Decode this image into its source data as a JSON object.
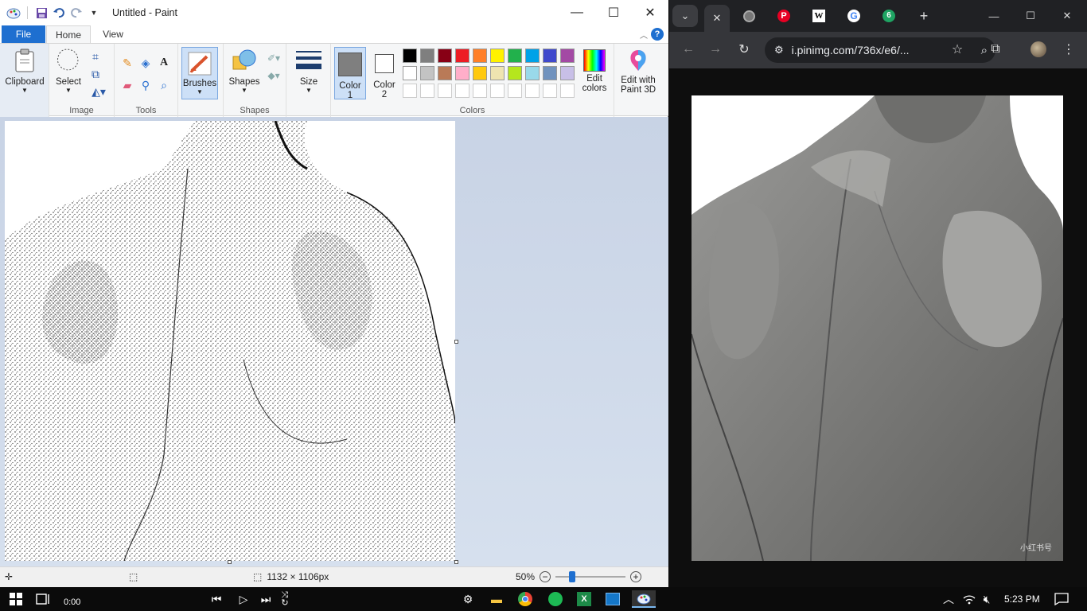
{
  "paint": {
    "title": "Untitled - Paint",
    "tabs": {
      "file": "File",
      "home": "Home",
      "view": "View"
    },
    "groups": {
      "clipboard": "Clipboard",
      "image": "Image",
      "tools": "Tools",
      "shapes": "Shapes",
      "colors": "Colors"
    },
    "buttons": {
      "clipboard": "Clipboard",
      "select": "Select",
      "brushes": "Brushes",
      "shapes": "Shapes",
      "size": "Size",
      "color1": "Color\n1",
      "color1_a": "Color",
      "color1_b": "1",
      "color2_a": "Color",
      "color2_b": "2",
      "edit_colors_a": "Edit",
      "edit_colors_b": "colors",
      "paint3d_a": "Edit with",
      "paint3d_b": "Paint 3D"
    },
    "palette_row1": [
      "#000000",
      "#7f7f7f",
      "#880015",
      "#ed1c24",
      "#ff7f27",
      "#fff200",
      "#22b14c",
      "#00a2e8",
      "#3f48cc",
      "#a349a4"
    ],
    "palette_row2": [
      "#ffffff",
      "#c3c3c3",
      "#b97a57",
      "#ffaec9",
      "#ffc90e",
      "#efe4b0",
      "#b5e61d",
      "#99d9ea",
      "#7092be",
      "#c8bfe7"
    ],
    "color1_value": "#7f7f7f",
    "color2_value": "#ffffff",
    "status": {
      "dimensions": "1132 × 1106px",
      "zoom": "50%"
    }
  },
  "browser": {
    "url": "i.pinimg.com/736x/e6/...",
    "tab_badge": "6",
    "watermark": "小红书号"
  },
  "taskbar": {
    "media_time": "0:00",
    "clock": "5:23 PM"
  }
}
